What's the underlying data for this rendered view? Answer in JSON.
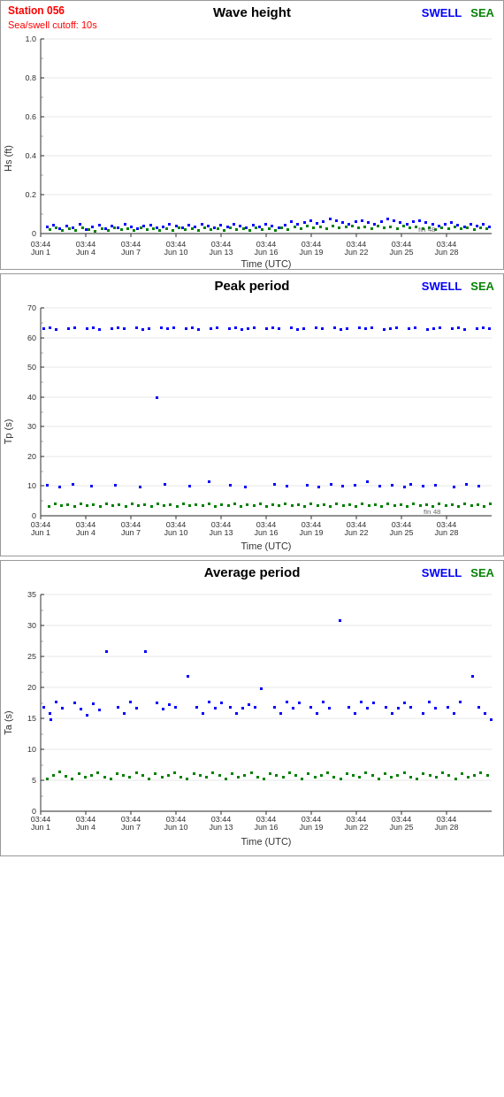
{
  "charts": [
    {
      "id": "wave-height",
      "station": "Station 056",
      "cutoff": "Sea/swell cutoff: 10s",
      "title": "Wave height",
      "yLabel": "Hs (ft)",
      "yMax": 1.0,
      "yTicks": [
        0,
        0.2,
        0.4,
        0.6,
        0.8,
        1.0
      ],
      "legend": {
        "swell": "SWELL",
        "sea": "SEA"
      },
      "xLabels": [
        "03:44\nJun 1",
        "03:44\nJun 4",
        "03:44\nJun 7",
        "03:44\nJun 10",
        "03:44\nJun 13",
        "03:44\nJun 16",
        "03:44\nJun 19",
        "03:44\nJun 22",
        "03:44\nJun 25",
        "03:44\nJun 28"
      ],
      "xLabel": "Time (UTC)"
    },
    {
      "id": "peak-period",
      "title": "Peak period",
      "yLabel": "Tp (s)",
      "yMax": 70,
      "yTicks": [
        0,
        10,
        20,
        30,
        40,
        50,
        60,
        70
      ],
      "legend": {
        "swell": "SWELL",
        "sea": "SEA"
      },
      "xLabels": [
        "03:44\nJun 1",
        "03:44\nJun 4",
        "03:44\nJun 7",
        "03:44\nJun 10",
        "03:44\nJun 13",
        "03:44\nJun 16",
        "03:44\nJun 19",
        "03:44\nJun 22",
        "03:44\nJun 25",
        "03:44\nJun 28"
      ],
      "xLabel": "Time (UTC)"
    },
    {
      "id": "avg-period",
      "title": "Average period",
      "yLabel": "Ta (s)",
      "yMax": 35,
      "yTicks": [
        0,
        5,
        10,
        15,
        20,
        25,
        30,
        35
      ],
      "legend": {
        "swell": "SWELL",
        "sea": "SEA"
      },
      "xLabels": [
        "03:44\nJun 1",
        "03:44\nJun 4",
        "03:44\nJun 7",
        "03:44\nJun 10",
        "03:44\nJun 13",
        "03:44\nJun 16",
        "03:44\nJun 19",
        "03:44\nJun 22",
        "03:44\nJun 25",
        "03:44\nJun 28"
      ],
      "xLabel": "Time (UTC)"
    }
  ]
}
